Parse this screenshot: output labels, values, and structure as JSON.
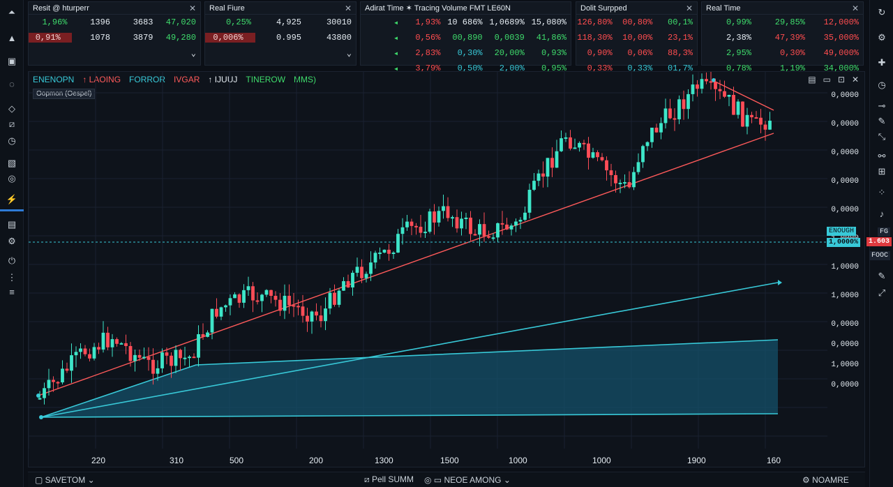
{
  "panels": [
    {
      "title": "Resit @ hturperr",
      "rows": [
        [
          {
            "t": "1,96%",
            "c": "g"
          },
          {
            "t": "1396",
            "c": "w"
          },
          {
            "t": "3683",
            "c": "w"
          },
          {
            "t": "47,020",
            "c": "g"
          }
        ],
        [
          {
            "t": "0,91%",
            "c": "hl"
          },
          {
            "t": "1078",
            "c": "w"
          },
          {
            "t": "3879",
            "c": "w"
          },
          {
            "t": "49,280",
            "c": "g"
          }
        ],
        [
          {
            "t": "",
            "c": "w"
          },
          {
            "t": "",
            "c": "w"
          },
          {
            "t": "",
            "c": "w"
          },
          {
            "t": "⌄",
            "c": "w"
          }
        ]
      ]
    },
    {
      "title": "Real Fiure",
      "rows": [
        [
          {
            "t": "0,25%",
            "c": "g"
          },
          {
            "t": "4,925",
            "c": "w"
          },
          {
            "t": "30010",
            "c": "w"
          }
        ],
        [
          {
            "t": "0,006%",
            "c": "hl"
          },
          {
            "t": "0.995",
            "c": "w"
          },
          {
            "t": "43800",
            "c": "w"
          }
        ],
        [
          {
            "t": "",
            "c": "w"
          },
          {
            "t": "",
            "c": "w"
          },
          {
            "t": "⌄",
            "c": "w"
          }
        ]
      ]
    },
    {
      "title": "Adirat Time  ✶  Tracing Volume          FMT LE60N",
      "rows": [
        [
          {
            "t": "◂",
            "c": "g"
          },
          {
            "t": "1,93%",
            "c": "r"
          },
          {
            "t": "10 686%",
            "c": "w"
          },
          {
            "t": "1,0689%",
            "c": "w"
          },
          {
            "t": "15,080%",
            "c": "w"
          }
        ],
        [
          {
            "t": "◂",
            "c": "g"
          },
          {
            "t": "0,56%",
            "c": "r"
          },
          {
            "t": "00,890",
            "c": "g"
          },
          {
            "t": "0,0039",
            "c": "g"
          },
          {
            "t": "41,86%",
            "c": "g"
          }
        ],
        [
          {
            "t": "◂",
            "c": "g"
          },
          {
            "t": "2,83%",
            "c": "r"
          },
          {
            "t": "0,30%",
            "c": "c"
          },
          {
            "t": "20,00%",
            "c": "g"
          },
          {
            "t": "0,93%",
            "c": "g"
          }
        ],
        [
          {
            "t": "◂",
            "c": "g"
          },
          {
            "t": "3,79%",
            "c": "r"
          },
          {
            "t": "0,50%",
            "c": "c"
          },
          {
            "t": "2,00%",
            "c": "c"
          },
          {
            "t": "0,95%",
            "c": "g"
          }
        ]
      ]
    },
    {
      "title": "Dolit Surpped",
      "rows": [
        [
          {
            "t": "126,80%",
            "c": "r"
          },
          {
            "t": "00,80%",
            "c": "r"
          },
          {
            "t": "00,1%",
            "c": "g"
          }
        ],
        [
          {
            "t": "118,30%",
            "c": "r"
          },
          {
            "t": "10,00%",
            "c": "r"
          },
          {
            "t": "23,1%",
            "c": "r"
          }
        ],
        [
          {
            "t": "0,90%",
            "c": "r"
          },
          {
            "t": "0,06%",
            "c": "r"
          },
          {
            "t": "88,3%",
            "c": "r"
          }
        ],
        [
          {
            "t": "0,33%",
            "c": "r"
          },
          {
            "t": "0,33%",
            "c": "c"
          },
          {
            "t": "01,7%",
            "c": "c"
          }
        ]
      ]
    },
    {
      "title": "Real Time",
      "rows": [
        [
          {
            "t": "0,99%",
            "c": "g"
          },
          {
            "t": "29,85%",
            "c": "g"
          },
          {
            "t": "12,000%",
            "c": "r"
          }
        ],
        [
          {
            "t": "2,38%",
            "c": "w"
          },
          {
            "t": "47,39%",
            "c": "r"
          },
          {
            "t": "35,000%",
            "c": "r"
          }
        ],
        [
          {
            "t": "2,95%",
            "c": "g"
          },
          {
            "t": "0,30%",
            "c": "r"
          },
          {
            "t": "49,000%",
            "c": "r"
          }
        ],
        [
          {
            "t": "0,78%",
            "c": "g"
          },
          {
            "t": "1,19%",
            "c": "g"
          },
          {
            "t": "34,000%",
            "c": "g"
          }
        ]
      ]
    }
  ],
  "chart": {
    "tabs": [
      {
        "label": "ENENOPN",
        "color": "#38c9d8"
      },
      {
        "label": "↑ LAOING",
        "color": "#ff5a5a"
      },
      {
        "label": "FORROR",
        "color": "#38c9d8"
      },
      {
        "label": "IVGAR",
        "color": "#ff5a5a"
      },
      {
        "label": "↑ IJUUJ",
        "color": "#e6edf3"
      },
      {
        "label": "TINEROW",
        "color": "#3fdc6c"
      },
      {
        "label": "MMS)",
        "color": "#3fdc6c"
      }
    ],
    "sub_label": "Oopmon (Oespel)",
    "controls": [
      "▤",
      "▭",
      "⊡",
      "✕"
    ],
    "y_ticks": [
      "0,0000",
      "0,0000",
      "0,0000",
      "0,0000",
      "0,0000",
      "1,0000",
      "1,0000",
      "1,0000",
      "0,0000",
      "0,0000",
      "1,0000",
      "0,0000"
    ],
    "x_ticks": [
      "220",
      "310",
      "500",
      "200",
      "1300",
      "1500",
      "1000",
      "1000",
      "1900",
      "160"
    ],
    "price_tag_cyan": "1,0000%",
    "price_tag_cyan_top": "ENOUGH",
    "price_tag_red": "1.603",
    "price_tag_right_top": "FG",
    "price_tag_right_bottom": "FOOC",
    "colors": {
      "up": "#3ee6c9",
      "down": "#ff4d57",
      "trend": "#ff5a5a",
      "line": "#38c9d8",
      "area": "#14506a"
    }
  },
  "bottom": {
    "left_label": "SAVETOM",
    "mid_label": "Pell SUMM",
    "mid2_label": "NEOE AMONG",
    "right_label": "NOAMRE"
  }
}
